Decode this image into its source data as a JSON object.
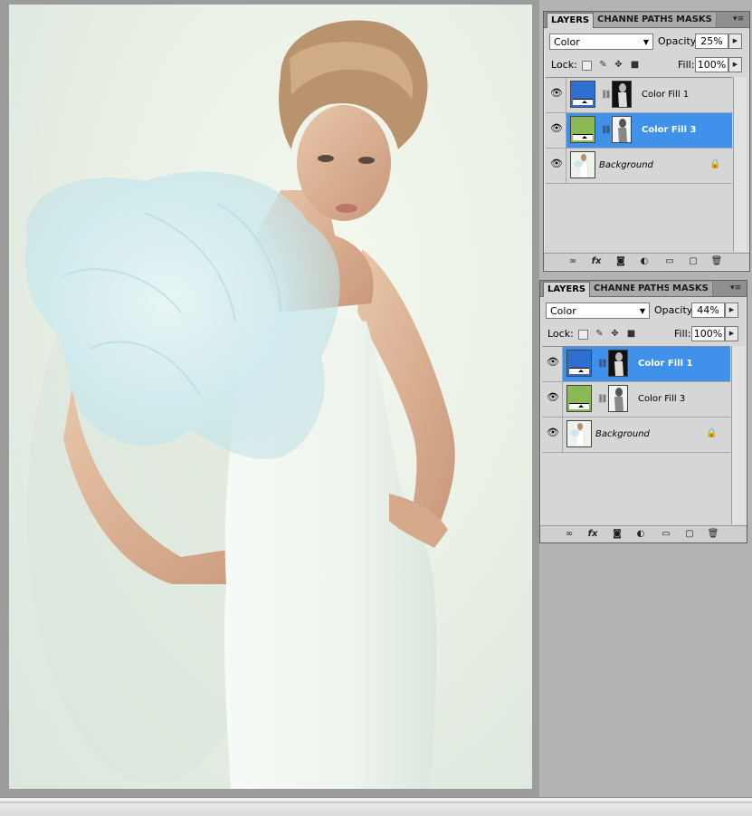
{
  "panels": [
    {
      "tabs": {
        "layers": "LAYERS",
        "channels": "CHANNE",
        "paths": "PATHS",
        "masks": "MASKS",
        "menu": "▾≡"
      },
      "blend_mode": "Color",
      "opacity_label": "Opacity:",
      "opacity_value": "25%",
      "lock_label": "Lock:",
      "fill_label": "Fill:",
      "fill_value": "100%",
      "layers": [
        {
          "name": "Color Fill 1",
          "swatch": "#2f6fd1",
          "mask": "dark",
          "selected": false
        },
        {
          "name": "Color Fill 3",
          "swatch": "#8ab852",
          "mask": "light",
          "selected": true
        },
        {
          "name": "Background",
          "swatch": "photo",
          "mask": "none",
          "selected": false,
          "locked": true
        }
      ]
    },
    {
      "tabs": {
        "layers": "LAYERS",
        "channels": "CHANNE",
        "paths": "PATHS",
        "masks": "MASKS",
        "menu": "▾≡"
      },
      "blend_mode": "Color",
      "opacity_label": "Opacity:",
      "opacity_value": "44%",
      "lock_label": "Lock:",
      "fill_label": "Fill:",
      "fill_value": "100%",
      "layers": [
        {
          "name": "Color Fill 1",
          "swatch": "#2f6fd1",
          "mask": "dark",
          "selected": true
        },
        {
          "name": "Color Fill 3",
          "swatch": "#8ab852",
          "mask": "light",
          "selected": false
        },
        {
          "name": "Background",
          "swatch": "photo",
          "mask": "none",
          "selected": false,
          "locked": true
        }
      ]
    }
  ],
  "icons": {
    "eye": "eye-icon",
    "chain": "link-icon",
    "lock": "lock-icon",
    "footer": [
      "link-layers-icon",
      "fx-icon",
      "add-mask-icon",
      "adjustment-layer-icon",
      "new-group-icon",
      "new-layer-icon",
      "trash-icon"
    ]
  },
  "colors": {
    "selection": "#3f91ea",
    "blue_fill": "#2f6fd1",
    "green_fill": "#8ab852"
  }
}
